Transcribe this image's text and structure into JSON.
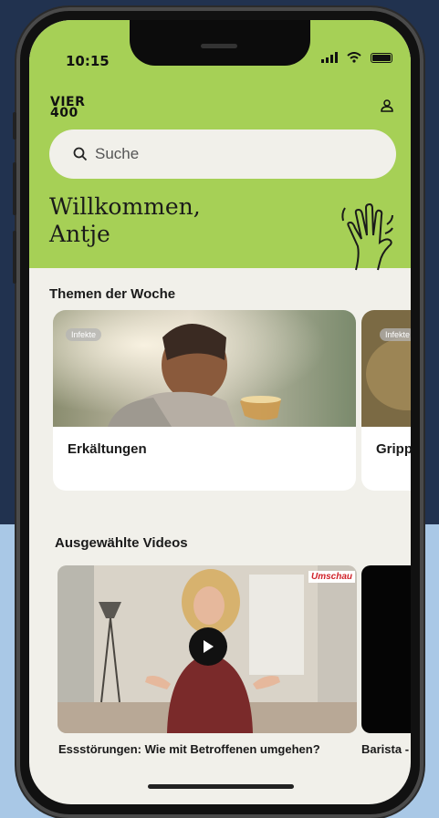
{
  "status_bar": {
    "time": "10:15"
  },
  "header": {
    "logo_line1": "VIER",
    "logo_line2": "400",
    "profile_icon": "user-icon"
  },
  "search": {
    "placeholder": "Suche",
    "icon": "search-icon"
  },
  "welcome": {
    "line1": "Willkommen,",
    "line2": "Antje",
    "icon": "waving-hand-icon"
  },
  "topics": {
    "title": "Themen der Woche",
    "cards": [
      {
        "tag": "Infekte",
        "title": "Erkältungen"
      },
      {
        "tag": "Infekte",
        "title": "Gripp"
      }
    ]
  },
  "videos": {
    "title": "Ausgewählte Videos",
    "items": [
      {
        "title": "Essstörungen: Wie mit Betroffenen umgehen?",
        "badge": "Umschau"
      },
      {
        "title": "Barista -"
      }
    ]
  },
  "colors": {
    "brand_green": "#a6d056",
    "background_dark": "#21324f",
    "background_light": "#a9c8e6",
    "app_background": "#f1f0ea"
  }
}
